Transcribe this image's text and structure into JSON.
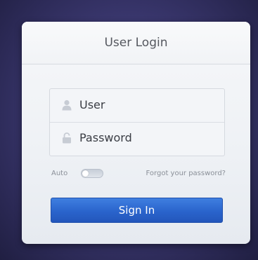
{
  "login": {
    "title": "User Login",
    "username_placeholder": "User",
    "password_placeholder": "Password",
    "auto_label": "Auto",
    "auto_toggle_on": false,
    "forgot_link": "Forgot your password?",
    "signin_label": "Sign In"
  },
  "icons": {
    "user_field": "user-icon",
    "password_field": "lock-icon"
  },
  "colors": {
    "accent": "#2a64cc",
    "background": "#3b3870"
  }
}
